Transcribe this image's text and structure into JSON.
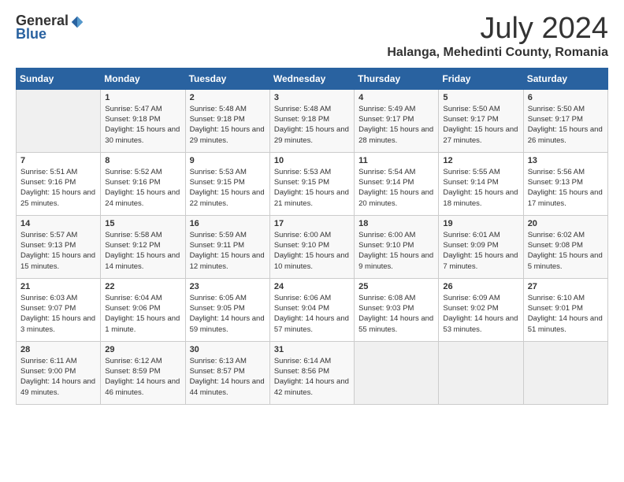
{
  "header": {
    "logo_general": "General",
    "logo_blue": "Blue",
    "month": "July 2024",
    "location": "Halanga, Mehedinti County, Romania"
  },
  "calendar": {
    "days_of_week": [
      "Sunday",
      "Monday",
      "Tuesday",
      "Wednesday",
      "Thursday",
      "Friday",
      "Saturday"
    ],
    "weeks": [
      [
        {
          "day": "",
          "sunrise": "",
          "sunset": "",
          "daylight": ""
        },
        {
          "day": "1",
          "sunrise": "Sunrise: 5:47 AM",
          "sunset": "Sunset: 9:18 PM",
          "daylight": "Daylight: 15 hours and 30 minutes."
        },
        {
          "day": "2",
          "sunrise": "Sunrise: 5:48 AM",
          "sunset": "Sunset: 9:18 PM",
          "daylight": "Daylight: 15 hours and 29 minutes."
        },
        {
          "day": "3",
          "sunrise": "Sunrise: 5:48 AM",
          "sunset": "Sunset: 9:18 PM",
          "daylight": "Daylight: 15 hours and 29 minutes."
        },
        {
          "day": "4",
          "sunrise": "Sunrise: 5:49 AM",
          "sunset": "Sunset: 9:17 PM",
          "daylight": "Daylight: 15 hours and 28 minutes."
        },
        {
          "day": "5",
          "sunrise": "Sunrise: 5:50 AM",
          "sunset": "Sunset: 9:17 PM",
          "daylight": "Daylight: 15 hours and 27 minutes."
        },
        {
          "day": "6",
          "sunrise": "Sunrise: 5:50 AM",
          "sunset": "Sunset: 9:17 PM",
          "daylight": "Daylight: 15 hours and 26 minutes."
        }
      ],
      [
        {
          "day": "7",
          "sunrise": "Sunrise: 5:51 AM",
          "sunset": "Sunset: 9:16 PM",
          "daylight": "Daylight: 15 hours and 25 minutes."
        },
        {
          "day": "8",
          "sunrise": "Sunrise: 5:52 AM",
          "sunset": "Sunset: 9:16 PM",
          "daylight": "Daylight: 15 hours and 24 minutes."
        },
        {
          "day": "9",
          "sunrise": "Sunrise: 5:53 AM",
          "sunset": "Sunset: 9:15 PM",
          "daylight": "Daylight: 15 hours and 22 minutes."
        },
        {
          "day": "10",
          "sunrise": "Sunrise: 5:53 AM",
          "sunset": "Sunset: 9:15 PM",
          "daylight": "Daylight: 15 hours and 21 minutes."
        },
        {
          "day": "11",
          "sunrise": "Sunrise: 5:54 AM",
          "sunset": "Sunset: 9:14 PM",
          "daylight": "Daylight: 15 hours and 20 minutes."
        },
        {
          "day": "12",
          "sunrise": "Sunrise: 5:55 AM",
          "sunset": "Sunset: 9:14 PM",
          "daylight": "Daylight: 15 hours and 18 minutes."
        },
        {
          "day": "13",
          "sunrise": "Sunrise: 5:56 AM",
          "sunset": "Sunset: 9:13 PM",
          "daylight": "Daylight: 15 hours and 17 minutes."
        }
      ],
      [
        {
          "day": "14",
          "sunrise": "Sunrise: 5:57 AM",
          "sunset": "Sunset: 9:13 PM",
          "daylight": "Daylight: 15 hours and 15 minutes."
        },
        {
          "day": "15",
          "sunrise": "Sunrise: 5:58 AM",
          "sunset": "Sunset: 9:12 PM",
          "daylight": "Daylight: 15 hours and 14 minutes."
        },
        {
          "day": "16",
          "sunrise": "Sunrise: 5:59 AM",
          "sunset": "Sunset: 9:11 PM",
          "daylight": "Daylight: 15 hours and 12 minutes."
        },
        {
          "day": "17",
          "sunrise": "Sunrise: 6:00 AM",
          "sunset": "Sunset: 9:10 PM",
          "daylight": "Daylight: 15 hours and 10 minutes."
        },
        {
          "day": "18",
          "sunrise": "Sunrise: 6:00 AM",
          "sunset": "Sunset: 9:10 PM",
          "daylight": "Daylight: 15 hours and 9 minutes."
        },
        {
          "day": "19",
          "sunrise": "Sunrise: 6:01 AM",
          "sunset": "Sunset: 9:09 PM",
          "daylight": "Daylight: 15 hours and 7 minutes."
        },
        {
          "day": "20",
          "sunrise": "Sunrise: 6:02 AM",
          "sunset": "Sunset: 9:08 PM",
          "daylight": "Daylight: 15 hours and 5 minutes."
        }
      ],
      [
        {
          "day": "21",
          "sunrise": "Sunrise: 6:03 AM",
          "sunset": "Sunset: 9:07 PM",
          "daylight": "Daylight: 15 hours and 3 minutes."
        },
        {
          "day": "22",
          "sunrise": "Sunrise: 6:04 AM",
          "sunset": "Sunset: 9:06 PM",
          "daylight": "Daylight: 15 hours and 1 minute."
        },
        {
          "day": "23",
          "sunrise": "Sunrise: 6:05 AM",
          "sunset": "Sunset: 9:05 PM",
          "daylight": "Daylight: 14 hours and 59 minutes."
        },
        {
          "day": "24",
          "sunrise": "Sunrise: 6:06 AM",
          "sunset": "Sunset: 9:04 PM",
          "daylight": "Daylight: 14 hours and 57 minutes."
        },
        {
          "day": "25",
          "sunrise": "Sunrise: 6:08 AM",
          "sunset": "Sunset: 9:03 PM",
          "daylight": "Daylight: 14 hours and 55 minutes."
        },
        {
          "day": "26",
          "sunrise": "Sunrise: 6:09 AM",
          "sunset": "Sunset: 9:02 PM",
          "daylight": "Daylight: 14 hours and 53 minutes."
        },
        {
          "day": "27",
          "sunrise": "Sunrise: 6:10 AM",
          "sunset": "Sunset: 9:01 PM",
          "daylight": "Daylight: 14 hours and 51 minutes."
        }
      ],
      [
        {
          "day": "28",
          "sunrise": "Sunrise: 6:11 AM",
          "sunset": "Sunset: 9:00 PM",
          "daylight": "Daylight: 14 hours and 49 minutes."
        },
        {
          "day": "29",
          "sunrise": "Sunrise: 6:12 AM",
          "sunset": "Sunset: 8:59 PM",
          "daylight": "Daylight: 14 hours and 46 minutes."
        },
        {
          "day": "30",
          "sunrise": "Sunrise: 6:13 AM",
          "sunset": "Sunset: 8:57 PM",
          "daylight": "Daylight: 14 hours and 44 minutes."
        },
        {
          "day": "31",
          "sunrise": "Sunrise: 6:14 AM",
          "sunset": "Sunset: 8:56 PM",
          "daylight": "Daylight: 14 hours and 42 minutes."
        },
        {
          "day": "",
          "sunrise": "",
          "sunset": "",
          "daylight": ""
        },
        {
          "day": "",
          "sunrise": "",
          "sunset": "",
          "daylight": ""
        },
        {
          "day": "",
          "sunrise": "",
          "sunset": "",
          "daylight": ""
        }
      ]
    ]
  }
}
